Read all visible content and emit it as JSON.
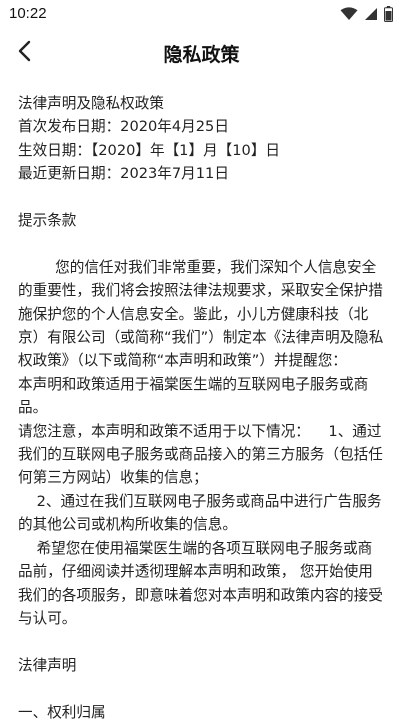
{
  "status_bar": {
    "time": "10:22",
    "icons": [
      "wifi-icon",
      "cellular-signal-icon",
      "battery-icon"
    ]
  },
  "nav": {
    "back_icon": "chevron-left-icon",
    "title": "隐私政策"
  },
  "doc": {
    "header": [
      "法律声明及隐私权政策",
      "首次发布日期：2020年4月25日",
      "生效日期：【2020】年【1】月【10】日",
      "最近更新日期：2023年7月11日"
    ],
    "section_title": "提示条款",
    "paragraphs": [
      "        您的信任对我们非常重要，我们深知个人信息安全的重要性，我们将会按照法律法规要求，采取安全保护措施保护您的个人信息安全。鉴此，小儿方健康科技（北京）有限公司（或简称“我们”）制定本《法律声明及隐私权政策》（以下或简称“本声明和政策”）并提醒您：",
      "本声明和政策适用于福棠医生端的互联网电子服务或商品。",
      "请您注意，本声明和政策不适用于以下情况：    1、通过我们的互联网电子服务或商品接入的第三方服务（包括任何第三方网站）收集的信息；",
      "    2、通过在我们互联网电子服务或商品中进行广告服务的其他公司或机构所收集的信息。",
      "    希望您在使用福棠医生端的各项互联网电子服务或商品前，仔细阅读并透彻理解本声明和政策， 您开始使用我们的各项服务，即意味着您对本声明和政策内容的接受与认可。"
    ],
    "section_title_2": "法律声明",
    "partial_heading": "一、权利归属"
  }
}
